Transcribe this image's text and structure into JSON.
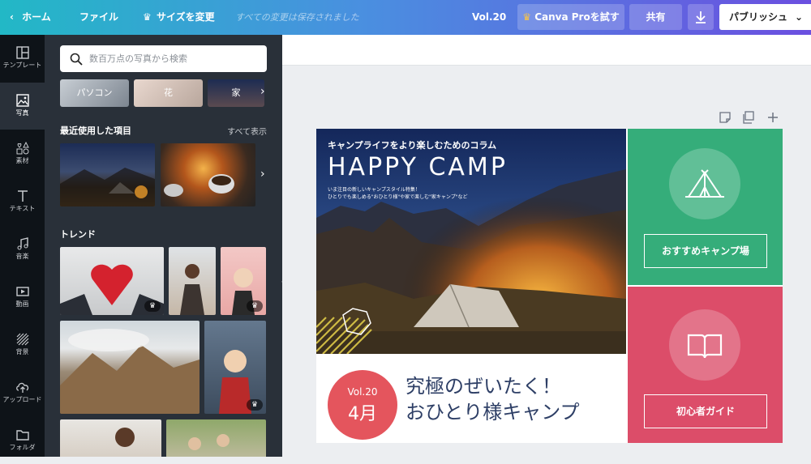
{
  "topbar": {
    "home": "ホーム",
    "file": "ファイル",
    "resize": "サイズを変更",
    "saved": "すべての変更は保存されました",
    "vol": "Vol.20",
    "try_pro": "Canva Proを試す",
    "share": "共有",
    "publish": "パブリッシュ"
  },
  "leftnav": [
    {
      "label": "テンプレート",
      "icon": "template-icon"
    },
    {
      "label": "写真",
      "icon": "photo-icon"
    },
    {
      "label": "素材",
      "icon": "elements-icon"
    },
    {
      "label": "テキスト",
      "icon": "text-icon"
    },
    {
      "label": "音楽",
      "icon": "music-icon"
    },
    {
      "label": "動画",
      "icon": "video-icon"
    },
    {
      "label": "背景",
      "icon": "background-icon"
    },
    {
      "label": "アップロード",
      "icon": "upload-icon"
    },
    {
      "label": "フォルダ",
      "icon": "folder-icon"
    }
  ],
  "panel": {
    "search_placeholder": "数百万点の写真から検索",
    "chips": [
      "パソコン",
      "花",
      "家"
    ],
    "recent_title": "最近使用した項目",
    "see_all": "すべて表示",
    "trend_title": "トレンド"
  },
  "design": {
    "photo_tagline": "キャンプライフをより楽しむためのコラム",
    "photo_title": "HAPPY CAMP",
    "photo_sub1": "いま注目の新しいキャンプスタイル特集！",
    "photo_sub2": "ひとりでも楽しめる\"おひとり様\"や家で楽しむ\"家キャンプ\"など",
    "card1_button": "おすすめキャンプ場",
    "card2_button": "初心者ガイド",
    "badge_vol": "Vol.20",
    "badge_month": "4月",
    "headline_line1": "究極のぜいたく！",
    "headline_line2": "おひとり様キャンプ"
  },
  "colors": {
    "green_card": "#35ad7a",
    "red_card": "#dc4d69",
    "badge": "#e4555d",
    "headline": "#2e3f66"
  }
}
